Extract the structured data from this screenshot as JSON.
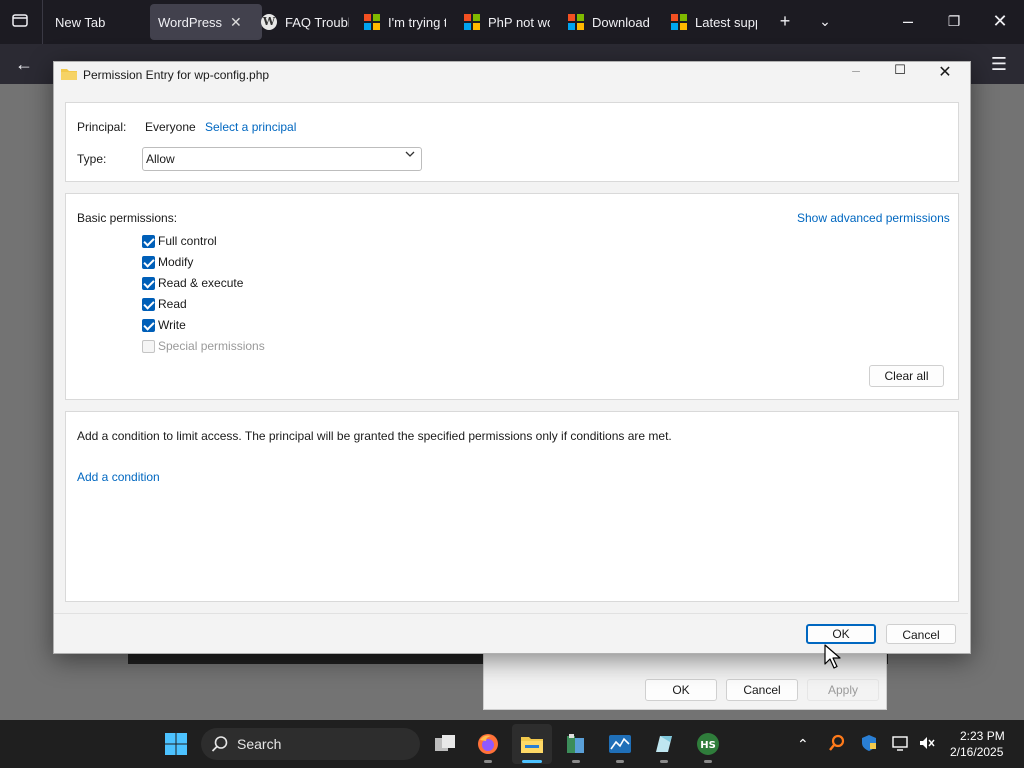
{
  "browser": {
    "tabs": [
      {
        "label": "New Tab",
        "active": false,
        "icon": "none"
      },
      {
        "label": "WordPress a",
        "active": true,
        "icon": "none"
      },
      {
        "label": "FAQ Troubl",
        "active": false,
        "icon": "wordpress-icon"
      },
      {
        "label": "I'm trying t",
        "active": false,
        "icon": "microsoft-icon"
      },
      {
        "label": "PhP not wo",
        "active": false,
        "icon": "microsoft-icon"
      },
      {
        "label": "Download",
        "active": false,
        "icon": "microsoft-icon"
      },
      {
        "label": "Latest supp",
        "active": false,
        "icon": "microsoft-icon"
      }
    ]
  },
  "dialog": {
    "title": "Permission Entry for wp-config.php",
    "principal_label": "Principal:",
    "principal_value": "Everyone",
    "select_principal": "Select a principal",
    "type_label": "Type:",
    "type_value": "Allow",
    "basic_permissions_label": "Basic permissions:",
    "show_advanced": "Show advanced permissions",
    "permissions": [
      {
        "label": "Full control",
        "checked": true,
        "disabled": false
      },
      {
        "label": "Modify",
        "checked": true,
        "disabled": false
      },
      {
        "label": "Read & execute",
        "checked": true,
        "disabled": false
      },
      {
        "label": "Read",
        "checked": true,
        "disabled": false
      },
      {
        "label": "Write",
        "checked": true,
        "disabled": false
      },
      {
        "label": "Special permissions",
        "checked": false,
        "disabled": true
      }
    ],
    "clear_all": "Clear all",
    "condition_text": "Add a condition to limit access. The principal will be granted the specified permissions only if conditions are met.",
    "add_condition": "Add a condition",
    "ok": "OK",
    "cancel": "Cancel"
  },
  "background_dialog": {
    "ok": "OK",
    "cancel": "Cancel",
    "apply": "Apply"
  },
  "taskbar": {
    "search_placeholder": "Search",
    "time": "2:23 PM",
    "date": "2/16/2025"
  },
  "colors": {
    "accent": "#005fb8",
    "link": "#0067c0"
  }
}
